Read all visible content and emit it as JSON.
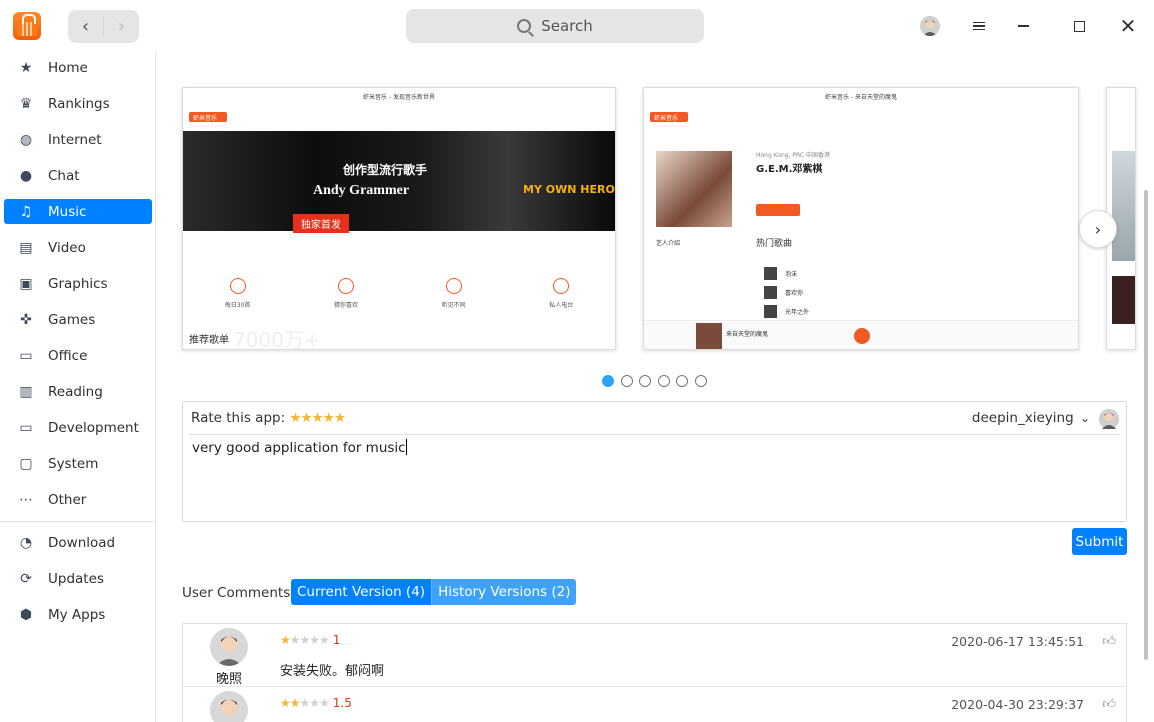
{
  "window": {
    "search_placeholder": "Search",
    "close_glyph": "✕"
  },
  "nav": {
    "back": "‹",
    "forward": "›"
  },
  "sidebar": {
    "items": [
      {
        "label": "Home",
        "icon": "star-icon",
        "glyph": "★"
      },
      {
        "label": "Rankings",
        "icon": "crown-icon",
        "glyph": "♛"
      },
      {
        "label": "Internet",
        "icon": "globe-icon",
        "glyph": "◍"
      },
      {
        "label": "Chat",
        "icon": "chat-bubble-icon",
        "glyph": "●"
      },
      {
        "label": "Music",
        "icon": "music-note-icon",
        "glyph": "♫",
        "active": true
      },
      {
        "label": "Video",
        "icon": "film-icon",
        "glyph": "▤"
      },
      {
        "label": "Graphics",
        "icon": "image-icon",
        "glyph": "▣"
      },
      {
        "label": "Games",
        "icon": "gamepad-icon",
        "glyph": "✜"
      },
      {
        "label": "Office",
        "icon": "presentation-icon",
        "glyph": "▭"
      },
      {
        "label": "Reading",
        "icon": "book-icon",
        "glyph": "▥"
      },
      {
        "label": "Development",
        "icon": "terminal-icon",
        "glyph": "▭"
      },
      {
        "label": "System",
        "icon": "monitor-icon",
        "glyph": "▢"
      },
      {
        "label": "Other",
        "icon": "more-dots-icon",
        "glyph": "⋯"
      }
    ],
    "bottom_items": [
      {
        "label": "Download",
        "icon": "download-icon",
        "glyph": "◔"
      },
      {
        "label": "Updates",
        "icon": "refresh-icon",
        "glyph": "⟳"
      },
      {
        "label": "My Apps",
        "icon": "package-icon",
        "glyph": "⬢"
      }
    ]
  },
  "screenshots": {
    "shot1": {
      "title": "虾米音乐 - 发现音乐新世界",
      "brand": "虾米音乐",
      "banner_line1": "创作型流行歌手",
      "banner_line2": "Andy Grammer",
      "banner_line3": "MY OWN HERO",
      "banner_badge": "独家首发",
      "feature_items": [
        "每日30首",
        "猜你喜欢",
        "听见不同",
        "私人电台"
      ],
      "footer_label": "推荐歌单",
      "footer_count": "7000万+"
    },
    "shot2": {
      "title": "虾米音乐 - 来自天堂的魔鬼",
      "brand": "虾米音乐",
      "artist_region": "Hong Kong, PRC 中国香港",
      "artist_name": "G.E.M.邓紫棋",
      "hot_songs_label": "热门歌曲",
      "intro_label": "艺人介绍",
      "songs": [
        "泡沫",
        "喜欢你",
        "光年之外"
      ],
      "now_playing": "来自天堂的魔鬼"
    },
    "page_count": 6,
    "active_page": 0
  },
  "rating": {
    "label": "Rate this app:",
    "stars_glyph": "★★★★★",
    "username": "deepin_xieying",
    "dropdown_glyph": "⌄",
    "comment_text": "very good application for music",
    "submit_label": "Submit"
  },
  "comments_section": {
    "label": "User Comments",
    "tabs": [
      "Current Version (4)",
      "History Versions (2)"
    ],
    "comments": [
      {
        "name": "晚照",
        "stars_filled": "★",
        "stars_empty": "★★★★",
        "score": "1",
        "body": "安装失败。郁闷啊",
        "date": "2020-06-17 13:45:51"
      },
      {
        "name": "",
        "stars_filled": "★★",
        "stars_empty": "★★★",
        "score": "1.5",
        "body": "",
        "date": "2020-04-30 23:29:37"
      }
    ]
  },
  "colors": {
    "accent": "#0081ff",
    "star": "#f5b731",
    "score": "#e5311a"
  }
}
